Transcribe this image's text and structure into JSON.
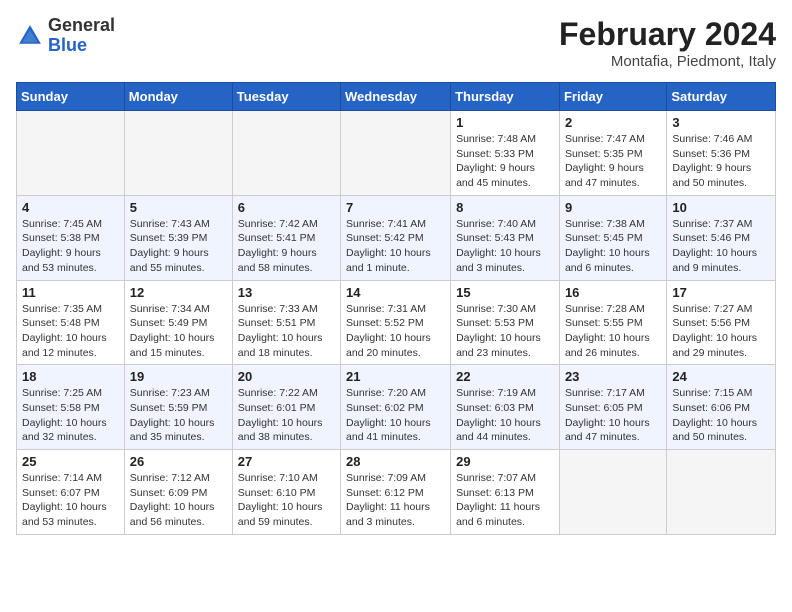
{
  "header": {
    "logo_general": "General",
    "logo_blue": "Blue",
    "month_year": "February 2024",
    "location": "Montafia, Piedmont, Italy"
  },
  "weekdays": [
    "Sunday",
    "Monday",
    "Tuesday",
    "Wednesday",
    "Thursday",
    "Friday",
    "Saturday"
  ],
  "weeks": [
    [
      {
        "day": "",
        "info": ""
      },
      {
        "day": "",
        "info": ""
      },
      {
        "day": "",
        "info": ""
      },
      {
        "day": "",
        "info": ""
      },
      {
        "day": "1",
        "info": "Sunrise: 7:48 AM\nSunset: 5:33 PM\nDaylight: 9 hours\nand 45 minutes."
      },
      {
        "day": "2",
        "info": "Sunrise: 7:47 AM\nSunset: 5:35 PM\nDaylight: 9 hours\nand 47 minutes."
      },
      {
        "day": "3",
        "info": "Sunrise: 7:46 AM\nSunset: 5:36 PM\nDaylight: 9 hours\nand 50 minutes."
      }
    ],
    [
      {
        "day": "4",
        "info": "Sunrise: 7:45 AM\nSunset: 5:38 PM\nDaylight: 9 hours\nand 53 minutes."
      },
      {
        "day": "5",
        "info": "Sunrise: 7:43 AM\nSunset: 5:39 PM\nDaylight: 9 hours\nand 55 minutes."
      },
      {
        "day": "6",
        "info": "Sunrise: 7:42 AM\nSunset: 5:41 PM\nDaylight: 9 hours\nand 58 minutes."
      },
      {
        "day": "7",
        "info": "Sunrise: 7:41 AM\nSunset: 5:42 PM\nDaylight: 10 hours\nand 1 minute."
      },
      {
        "day": "8",
        "info": "Sunrise: 7:40 AM\nSunset: 5:43 PM\nDaylight: 10 hours\nand 3 minutes."
      },
      {
        "day": "9",
        "info": "Sunrise: 7:38 AM\nSunset: 5:45 PM\nDaylight: 10 hours\nand 6 minutes."
      },
      {
        "day": "10",
        "info": "Sunrise: 7:37 AM\nSunset: 5:46 PM\nDaylight: 10 hours\nand 9 minutes."
      }
    ],
    [
      {
        "day": "11",
        "info": "Sunrise: 7:35 AM\nSunset: 5:48 PM\nDaylight: 10 hours\nand 12 minutes."
      },
      {
        "day": "12",
        "info": "Sunrise: 7:34 AM\nSunset: 5:49 PM\nDaylight: 10 hours\nand 15 minutes."
      },
      {
        "day": "13",
        "info": "Sunrise: 7:33 AM\nSunset: 5:51 PM\nDaylight: 10 hours\nand 18 minutes."
      },
      {
        "day": "14",
        "info": "Sunrise: 7:31 AM\nSunset: 5:52 PM\nDaylight: 10 hours\nand 20 minutes."
      },
      {
        "day": "15",
        "info": "Sunrise: 7:30 AM\nSunset: 5:53 PM\nDaylight: 10 hours\nand 23 minutes."
      },
      {
        "day": "16",
        "info": "Sunrise: 7:28 AM\nSunset: 5:55 PM\nDaylight: 10 hours\nand 26 minutes."
      },
      {
        "day": "17",
        "info": "Sunrise: 7:27 AM\nSunset: 5:56 PM\nDaylight: 10 hours\nand 29 minutes."
      }
    ],
    [
      {
        "day": "18",
        "info": "Sunrise: 7:25 AM\nSunset: 5:58 PM\nDaylight: 10 hours\nand 32 minutes."
      },
      {
        "day": "19",
        "info": "Sunrise: 7:23 AM\nSunset: 5:59 PM\nDaylight: 10 hours\nand 35 minutes."
      },
      {
        "day": "20",
        "info": "Sunrise: 7:22 AM\nSunset: 6:01 PM\nDaylight: 10 hours\nand 38 minutes."
      },
      {
        "day": "21",
        "info": "Sunrise: 7:20 AM\nSunset: 6:02 PM\nDaylight: 10 hours\nand 41 minutes."
      },
      {
        "day": "22",
        "info": "Sunrise: 7:19 AM\nSunset: 6:03 PM\nDaylight: 10 hours\nand 44 minutes."
      },
      {
        "day": "23",
        "info": "Sunrise: 7:17 AM\nSunset: 6:05 PM\nDaylight: 10 hours\nand 47 minutes."
      },
      {
        "day": "24",
        "info": "Sunrise: 7:15 AM\nSunset: 6:06 PM\nDaylight: 10 hours\nand 50 minutes."
      }
    ],
    [
      {
        "day": "25",
        "info": "Sunrise: 7:14 AM\nSunset: 6:07 PM\nDaylight: 10 hours\nand 53 minutes."
      },
      {
        "day": "26",
        "info": "Sunrise: 7:12 AM\nSunset: 6:09 PM\nDaylight: 10 hours\nand 56 minutes."
      },
      {
        "day": "27",
        "info": "Sunrise: 7:10 AM\nSunset: 6:10 PM\nDaylight: 10 hours\nand 59 minutes."
      },
      {
        "day": "28",
        "info": "Sunrise: 7:09 AM\nSunset: 6:12 PM\nDaylight: 11 hours\nand 3 minutes."
      },
      {
        "day": "29",
        "info": "Sunrise: 7:07 AM\nSunset: 6:13 PM\nDaylight: 11 hours\nand 6 minutes."
      },
      {
        "day": "",
        "info": ""
      },
      {
        "day": "",
        "info": ""
      }
    ]
  ]
}
